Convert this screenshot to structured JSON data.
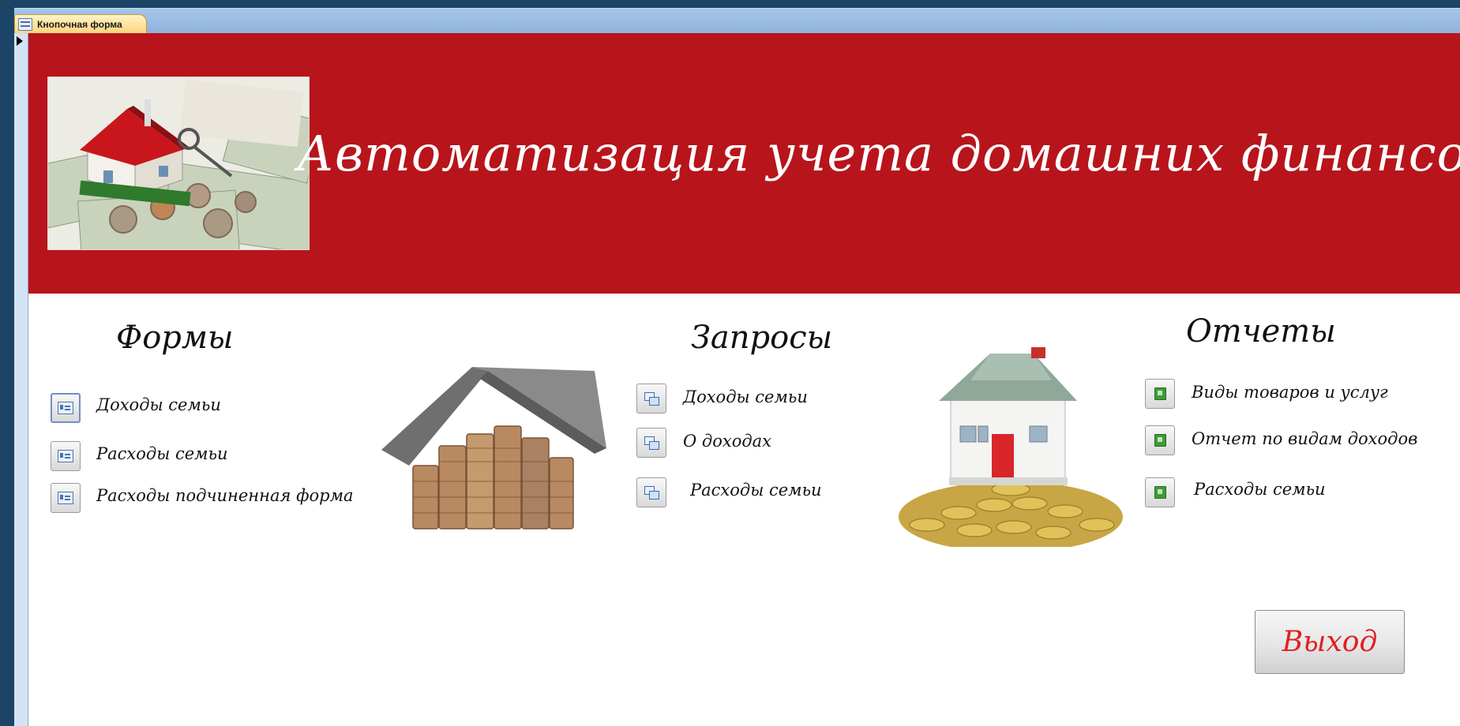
{
  "window": {
    "tab_title": "Кнопочная форма"
  },
  "header": {
    "title": "Автоматизация учета домашних финансов"
  },
  "sections": {
    "forms": {
      "title": "Формы",
      "items": [
        {
          "label": "Доходы семьи"
        },
        {
          "label": "Расходы семьи"
        },
        {
          "label": "Расходы подчиненная форма"
        }
      ]
    },
    "queries": {
      "title": "Запросы",
      "items": [
        {
          "label": "Доходы семьи"
        },
        {
          "label": "О доходах"
        },
        {
          "label": "Расходы семьи"
        }
      ]
    },
    "reports": {
      "title": "Отчеты",
      "items": [
        {
          "label": "Виды товаров и услуг"
        },
        {
          "label": "Отчет по видам доходов"
        },
        {
          "label": "Расходы семьи"
        }
      ]
    }
  },
  "exit": {
    "label": "Выход"
  },
  "colors": {
    "header_bg": "#b8141b",
    "exit_text": "#e02020",
    "tab_bg": "#fcd47a"
  }
}
